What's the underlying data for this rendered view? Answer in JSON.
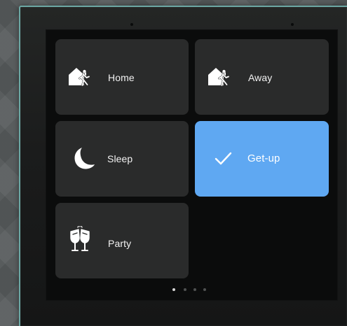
{
  "device": {
    "scene_tiles": [
      {
        "label": "Home",
        "icon": "house-walking-person-icon",
        "active": false
      },
      {
        "label": "Away",
        "icon": "house-walking-person-icon",
        "active": false
      },
      {
        "label": "Sleep",
        "icon": "crescent-moon-icon",
        "active": false
      },
      {
        "label": "Get-up",
        "icon": "checkmark-icon",
        "active": true
      },
      {
        "label": "Party",
        "icon": "champagne-glasses-icon",
        "active": false
      }
    ],
    "pagination": {
      "current_page": 1,
      "total_pages": 4
    },
    "colors": {
      "active_tile": "#5fa8f2",
      "inactive_tile": "#2a2b2b",
      "screen_background": "#0b0c0c",
      "frame_edge": "#6ca8a4"
    }
  }
}
